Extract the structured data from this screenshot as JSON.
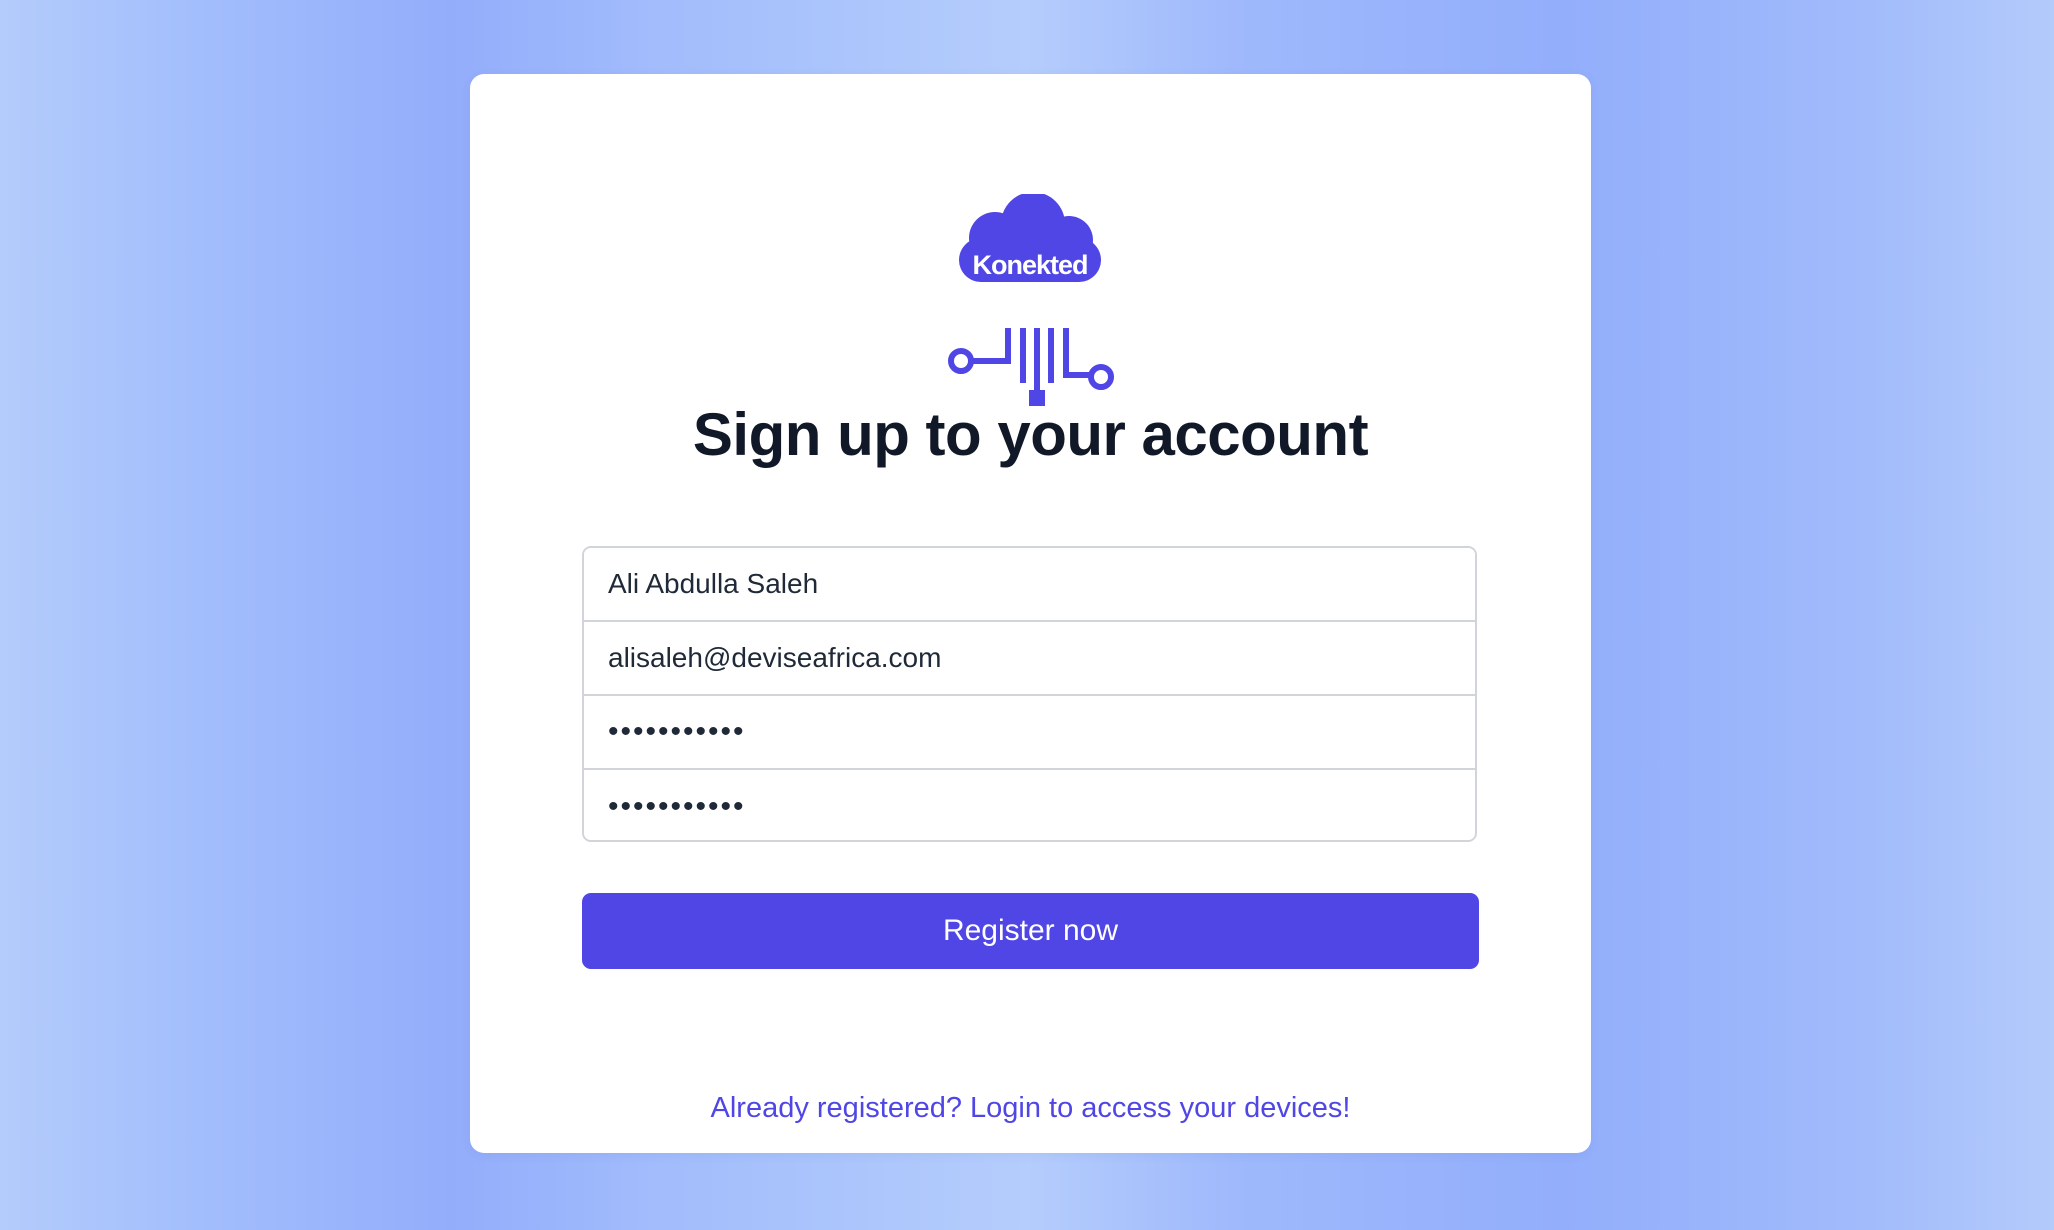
{
  "brand": {
    "logo_text": "Konekted",
    "logo_color": "#4f46e5"
  },
  "heading": "Sign up to your account",
  "form": {
    "name_value": "Ali Abdulla Saleh",
    "email_value": "alisaleh@deviseafrica.com",
    "password_value": "•••••••••••",
    "confirm_password_value": "•••••••••••"
  },
  "register_label": "Register now",
  "login_link": "Already registered? Login to access your devices!",
  "colors": {
    "accent": "#4f46e5",
    "heading": "#111827",
    "card": "#ffffff"
  }
}
